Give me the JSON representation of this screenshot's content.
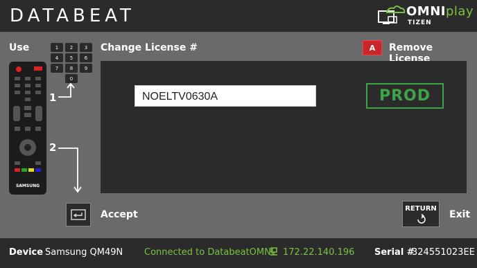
{
  "header": {
    "brand": "DATABEAT",
    "omni_brand": "OMNI",
    "omni_play": "play",
    "omni_platform": "TIZEN"
  },
  "sections": {
    "use": "Use",
    "change_license": "Change License #",
    "remove_license": "Remove License",
    "remove_key": "A"
  },
  "keypad": {
    "keys": [
      "1",
      "2",
      "3",
      "4",
      "5",
      "6",
      "7",
      "8",
      "9",
      "0"
    ]
  },
  "remote": {
    "brand": "SAMSUNG"
  },
  "license": {
    "value": "NOELTV0630A",
    "env_button": "PROD"
  },
  "steps": {
    "step1": "1",
    "step2": "2"
  },
  "actions": {
    "accept": "Accept",
    "return_key": "RETURN",
    "exit": "Exit"
  },
  "footer": {
    "device_label": "Device",
    "device_value": "Samsung QM49N",
    "connection": "Connected to DatabeatOMNI",
    "ip": "172.22.140.196",
    "serial_label": "Serial #",
    "serial_value": "324551023EE"
  },
  "colors": {
    "accent_green": "#7cc242",
    "prod_green": "#3da447",
    "red_key": "#c8262b"
  }
}
